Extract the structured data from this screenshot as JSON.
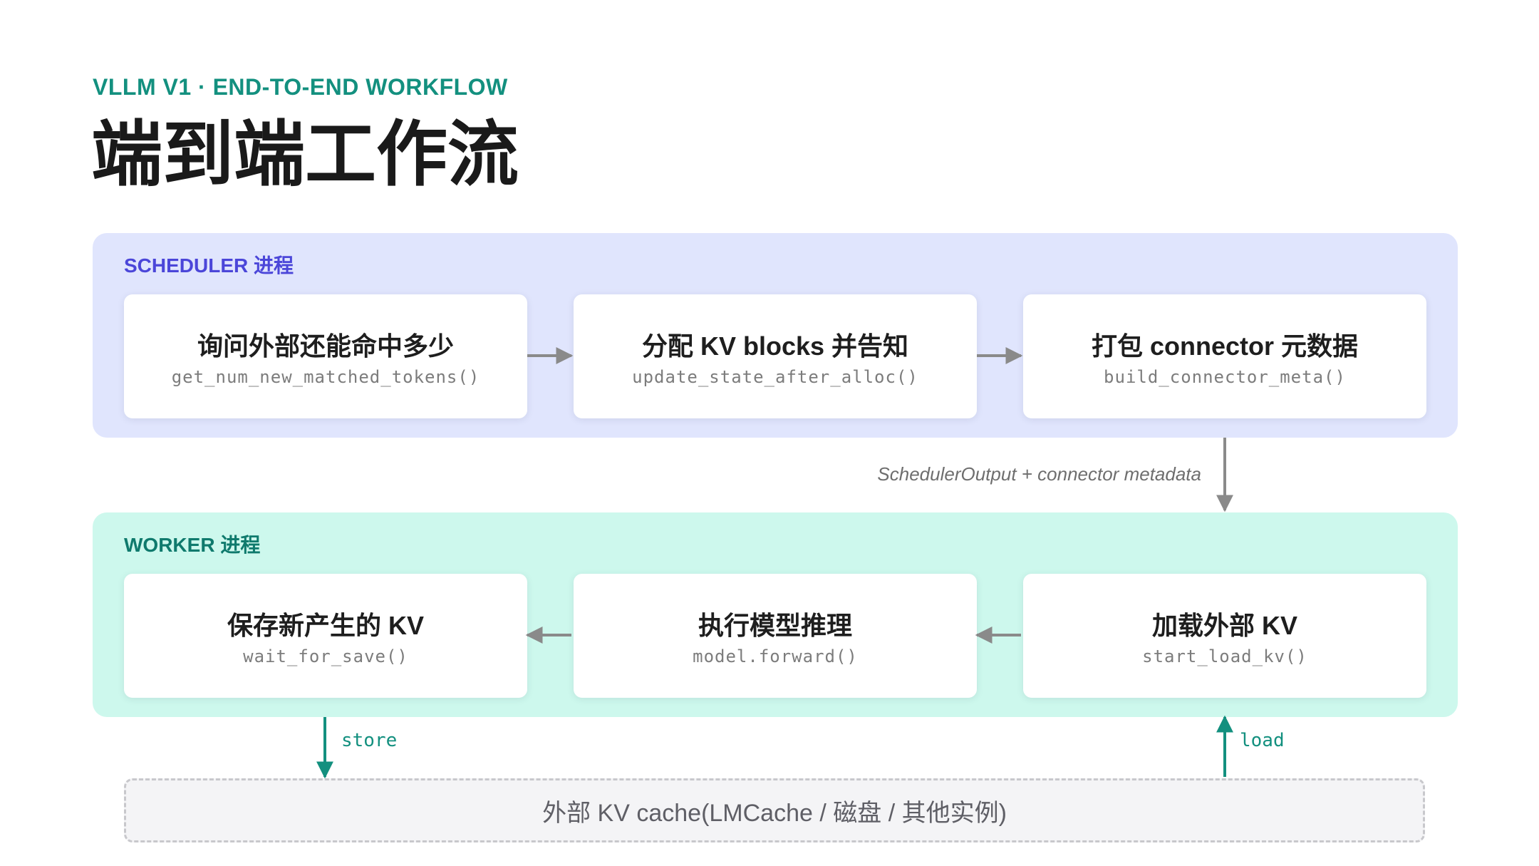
{
  "header": {
    "eyebrow": "VLLM V1 · END-TO-END WORKFLOW",
    "title": "端到端工作流"
  },
  "scheduler": {
    "label": "SCHEDULER 进程",
    "steps": [
      {
        "title": "询问外部还能命中多少",
        "fn": "get_num_new_matched_tokens()"
      },
      {
        "title": "分配 KV blocks 并告知",
        "fn": "update_state_after_alloc()"
      },
      {
        "title": "打包 connector 元数据",
        "fn": "build_connector_meta()"
      }
    ]
  },
  "handoff_label": "SchedulerOutput + connector metadata",
  "worker": {
    "label": "WORKER 进程",
    "steps": [
      {
        "title": "保存新产生的 KV",
        "fn": "wait_for_save()"
      },
      {
        "title": "执行模型推理",
        "fn": "model.forward()"
      },
      {
        "title": "加载外部 KV",
        "fn": "start_load_kv()"
      }
    ]
  },
  "storage": {
    "label": "外部 KV cache(LMCache / 磁盘 / 其他实例)",
    "store_label": "store",
    "load_label": "load"
  },
  "colors": {
    "accent": "#13907f",
    "scheduler_bg": "#e0e5fd",
    "scheduler_text": "#4b46d9",
    "worker_bg": "#cdf8ed",
    "worker_text": "#0f7a6d",
    "arrow_gray": "#8a8a8a"
  }
}
